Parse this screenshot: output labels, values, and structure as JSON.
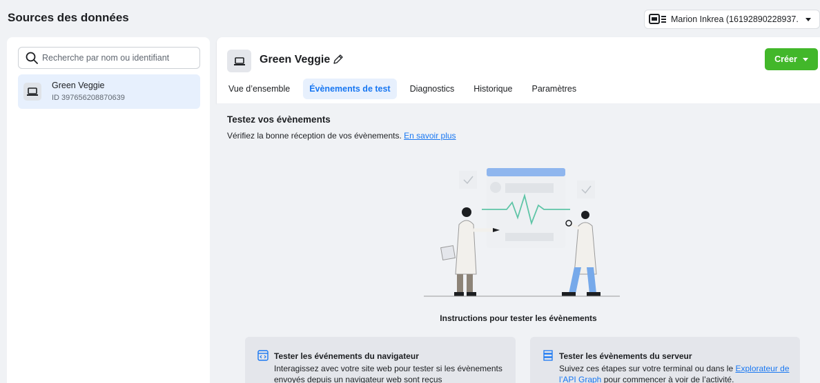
{
  "header": {
    "title": "Sources des données",
    "account": {
      "name": "Marion Inkrea (16192890228937...",
      "icon": "business-account-icon"
    }
  },
  "sidebar": {
    "search_placeholder": "Recherche par nom ou identifiant",
    "items": [
      {
        "name": "Green Veggie",
        "id": "ID 397656208870639",
        "icon": "laptop-icon",
        "selected": true
      }
    ]
  },
  "datasource": {
    "name": "Green Veggie",
    "create_label": "Créer",
    "tabs": [
      {
        "label": "Vue d’ensemble",
        "active": false
      },
      {
        "label": "Évènements de test",
        "active": true
      },
      {
        "label": "Diagnostics",
        "active": false
      },
      {
        "label": "Historique",
        "active": false
      },
      {
        "label": "Paramètres",
        "active": false
      }
    ]
  },
  "test_events": {
    "title": "Testez vos évènements",
    "description": "Vérifiez la bonne réception de vos évènements.",
    "learn_more": "En savoir plus",
    "instructions_title": "Instructions pour tester les évènements",
    "browser_card": {
      "title": "Tester les événements du navigateur",
      "text": "Interagissez avec votre site web pour tester si les évènements envoyés depuis un navigateur web sont reçus"
    },
    "server_card": {
      "title": "Tester les évènements du serveur",
      "text_before": "Suivez ces étapes sur votre terminal ou dans le ",
      "link": "Explorateur de l’API Graph",
      "text_after": " pour commencer à voir de l’activité."
    }
  },
  "colors": {
    "accent": "#1877f2",
    "create_button": "#42b72a",
    "selected_bg": "#e7f0fd",
    "page_bg": "#f0f2f5"
  }
}
